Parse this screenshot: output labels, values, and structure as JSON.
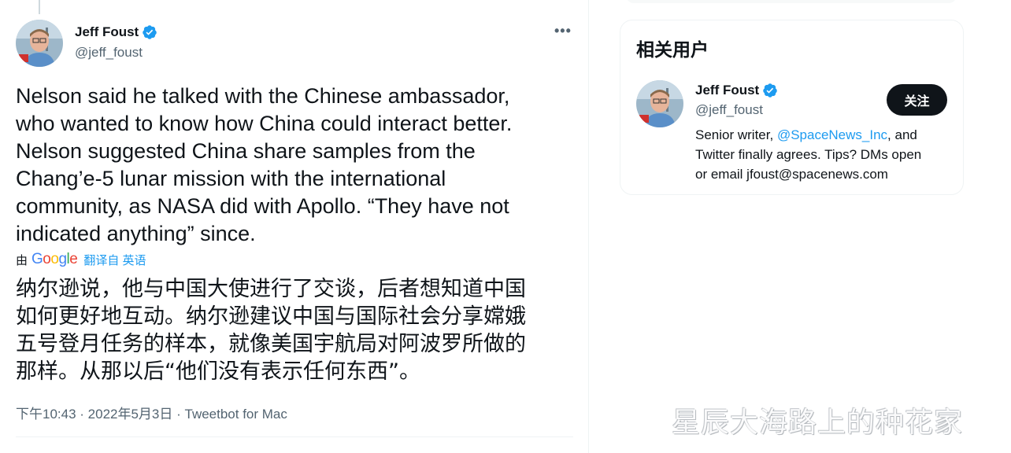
{
  "tweet": {
    "author_name": "Jeff Foust",
    "author_handle": "@jeff_foust",
    "more_glyph": "•••",
    "text_lines": [
      "Nelson said he talked with the Chinese ambassador,",
      "who wanted to know how China could interact better.",
      "Nelson suggested China share samples from the",
      "Chang’e-5 lunar mission with the international",
      "community, as NASA did with Apollo. “They have not",
      "indicated anything” since."
    ],
    "translate_by": "由",
    "translate_provider": "Google",
    "translate_link": "翻译自 英语",
    "translated_lines": [
      "纳尔逊说，他与中国大使进行了交谈，后者想知道中国",
      "如何更好地互动。纳尔逊建议中国与国际社会分享嫦娥",
      "五号登月任务的样本，就像美国宇航局对阿波罗所做的",
      "那样。从那以后“他们没有表示任何东西”。"
    ],
    "time": "下午10:43",
    "date": "2022年5月3日",
    "source": "Tweetbot for Mac",
    "separator": " · "
  },
  "sidebar": {
    "related_title": "相关用户",
    "user": {
      "name": "Jeff Foust",
      "handle": "@jeff_foust",
      "follow_label": "关注",
      "bio_prefix": "Senior writer, ",
      "bio_mention": "@SpaceNews_Inc",
      "bio_rest_1": ", and",
      "bio_line_2": "Twitter finally agrees. Tips? DMs open",
      "bio_line_3": "or email jfoust@spacenews.com"
    }
  },
  "watermark": "星辰大海路上的种花家",
  "colors": {
    "verified": "#1d9bf0",
    "link": "#1d9bf0",
    "text_primary": "#0f1419",
    "text_secondary": "#536471",
    "follow_button_bg": "#0f1419"
  },
  "icons": {
    "verified": "verified-badge-icon",
    "more": "more-horizontal-icon"
  }
}
